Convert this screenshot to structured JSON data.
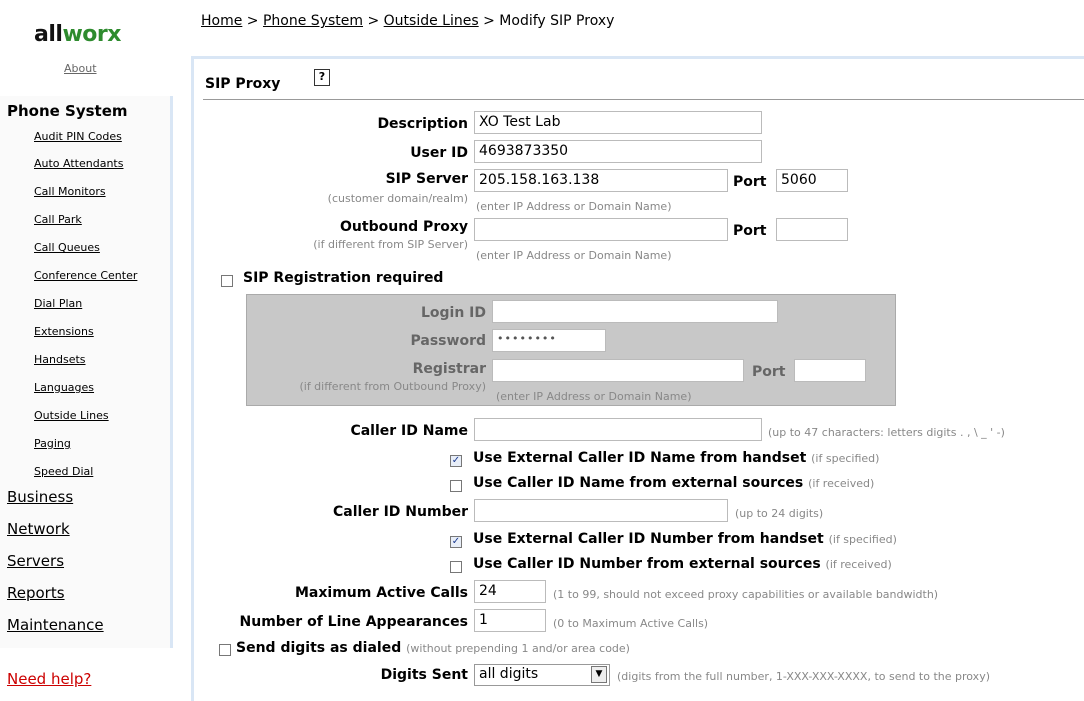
{
  "logo": {
    "text_a": "all",
    "text_b": "worx"
  },
  "nav": {
    "about": "About",
    "section": "Phone System",
    "items": [
      "Audit PIN Codes",
      "Auto Attendants",
      "Call Monitors",
      "Call Park",
      "Call Queues",
      "Conference Center",
      "Dial Plan",
      "Extensions",
      "Handsets",
      "Languages",
      "Outside Lines",
      "Paging",
      "Speed Dial"
    ],
    "main": [
      "Business",
      "Network",
      "Servers",
      "Reports",
      "Maintenance"
    ],
    "help": "Need help?"
  },
  "breadcrumb": {
    "home": "Home",
    "sep": " > ",
    "phone": "Phone System",
    "lines": "Outside Lines",
    "current": "Modify SIP Proxy"
  },
  "panel": {
    "title": "SIP Proxy",
    "help_glyph": "?"
  },
  "form": {
    "description": {
      "label": "Description",
      "value": "XO Test Lab"
    },
    "user_id": {
      "label": "User ID",
      "value": "4693873350"
    },
    "sip_server": {
      "label": "SIP Server",
      "sub": "(customer domain/realm)",
      "value": "205.158.163.138",
      "hint": "(enter IP Address or Domain Name)",
      "port_label": "Port",
      "port": "5060"
    },
    "outbound_proxy": {
      "label": "Outbound Proxy",
      "sub": "(if different from SIP Server)",
      "value": "",
      "hint": "(enter IP Address or Domain Name)",
      "port_label": "Port",
      "port": ""
    },
    "sip_registration": {
      "label": "SIP Registration required",
      "checked": false
    },
    "login_id": {
      "label": "Login ID",
      "value": ""
    },
    "password": {
      "label": "Password",
      "value": "••••••••"
    },
    "registrar": {
      "label": "Registrar",
      "sub": "(if different from Outbound Proxy)",
      "value": "",
      "hint": "(enter IP Address or Domain Name)",
      "port_label": "Port",
      "port": ""
    },
    "caller_id_name": {
      "label": "Caller ID Name",
      "value": "",
      "hint": "(up to 47 characters: letters digits . , \\ _ ' -)"
    },
    "use_ext_name": {
      "label": "Use External Caller ID Name from handset",
      "note": "(if specified)",
      "checked": true
    },
    "use_name_external": {
      "label": "Use Caller ID Name from external sources",
      "note": "(if received)",
      "checked": false
    },
    "caller_id_number": {
      "label": "Caller ID Number",
      "value": "",
      "hint": "(up to 24 digits)"
    },
    "use_ext_number": {
      "label": "Use External Caller ID Number from handset",
      "note": "(if specified)",
      "checked": true
    },
    "use_number_external": {
      "label": "Use Caller ID Number from external sources",
      "note": "(if received)",
      "checked": false
    },
    "max_calls": {
      "label": "Maximum Active Calls",
      "value": "24",
      "hint": "(1 to 99, should not exceed proxy capabilities or available bandwidth)"
    },
    "line_appearances": {
      "label": "Number of Line Appearances",
      "value": "1",
      "hint": "(0 to Maximum Active Calls)"
    },
    "send_digits": {
      "label": "Send digits as dialed",
      "note": "(without prepending 1 and/or area code)",
      "checked": false
    },
    "digits_sent": {
      "label": "Digits Sent",
      "value": "all digits",
      "hint": "(digits from the full number, 1-XXX-XXX-XXXX, to send to the proxy)"
    }
  }
}
